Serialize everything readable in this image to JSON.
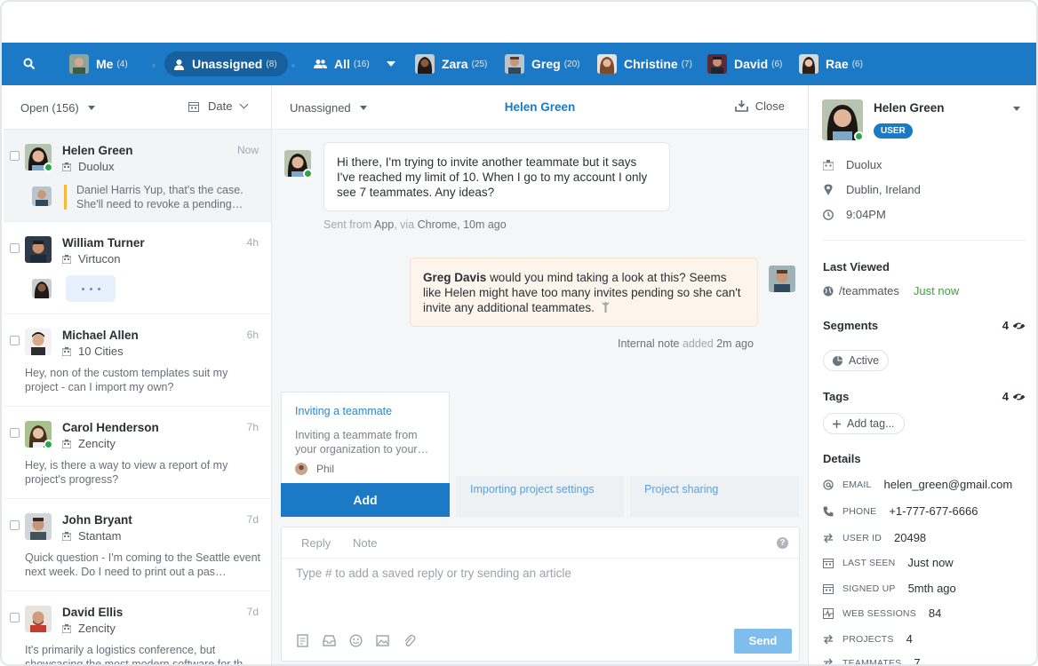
{
  "nav": {
    "items": [
      {
        "label": "Me",
        "count": "(4)"
      },
      {
        "label": "Unassigned",
        "count": "(8)"
      },
      {
        "label": "All",
        "count": "(16)"
      },
      {
        "label": "Zara",
        "count": "(25)"
      },
      {
        "label": "Greg",
        "count": "(20)"
      },
      {
        "label": "Christine",
        "count": "(7)"
      },
      {
        "label": "David",
        "count": "(6)"
      },
      {
        "label": "Rae",
        "count": "(6)"
      }
    ]
  },
  "inbox": {
    "filter_label": "Open (156)",
    "sort_label": "Date",
    "conversations": [
      {
        "name": "Helen Green",
        "time": "Now",
        "company": "Duolux",
        "preview": "Daniel Harris Yup, that's the case. She'll need to revoke a pending…"
      },
      {
        "name": "William Turner",
        "time": "4h",
        "company": "Virtucon",
        "preview": ""
      },
      {
        "name": "Michael Allen",
        "time": "6h",
        "company": "10 Cities",
        "preview": "Hey, non of the custom templates suit my project - can I import my own?"
      },
      {
        "name": "Carol Henderson",
        "time": "7h",
        "company": "Zencity",
        "preview": "Hey, is there a way to view a report of my project's progress?"
      },
      {
        "name": "John Bryant",
        "time": "7d",
        "company": "Stantam",
        "preview": "Quick question - I'm coming to the Seattle event next week. Do I need to print out a pas…"
      },
      {
        "name": "David Ellis",
        "time": "7d",
        "company": "Zencity",
        "preview": "It's primarily a logistics conference, but showcasing the most modern software for th…"
      }
    ]
  },
  "conversation": {
    "assignee": "Unassigned",
    "title": "Helen Green",
    "close_label": "Close",
    "message": "Hi there, I'm trying to invite another teammate but it says I've reached my limit of 10. When I go to my account I only see 7 teammates. Any ideas?",
    "message_meta": {
      "prefix": "Sent from",
      "app": "App",
      "via": ", via",
      "browser": "Chrome",
      "time": ", 10m ago"
    },
    "note_author": "Greg Davis",
    "note_text": "would you mind taking a look at this? Seems like Helen might have too many invites pending so she can't invite any additional teammates.",
    "note_meta": {
      "type": "Internal note",
      "verb": "added",
      "time": "2m ago"
    },
    "suggestion": {
      "title": "Inviting a teammate",
      "body": "Inviting a teammate from your organization to your…",
      "author": "Phil",
      "add_label": "Add"
    },
    "other_suggestions": [
      "Importing project settings",
      "Project sharing"
    ],
    "composer": {
      "tab_reply": "Reply",
      "tab_note": "Note",
      "help": "?",
      "placeholder": "Type # to add a saved reply or try sending an article",
      "send_label": "Send"
    }
  },
  "profile": {
    "name": "Helen Green",
    "badge": "USER",
    "company": "Duolux",
    "location": "Dublin, Ireland",
    "local_time": "9:04PM",
    "last_viewed_heading": "Last Viewed",
    "last_viewed_page": "/teammates",
    "last_viewed_time": "Just now",
    "segments_heading": "Segments",
    "segments_count": "4",
    "segment_chip": "Active",
    "tags_heading": "Tags",
    "tags_count": "4",
    "add_tag": "Add tag...",
    "details_heading": "Details",
    "details": [
      {
        "label": "EMAIL",
        "value": "helen_green@gmail.com"
      },
      {
        "label": "PHONE",
        "value": "+1-777-677-6666"
      },
      {
        "label": "USER ID",
        "value": "20498"
      },
      {
        "label": "LAST SEEN",
        "value": "Just now"
      },
      {
        "label": "SIGNED UP",
        "value": "5mth ago"
      },
      {
        "label": "WEB SESSIONS",
        "value": "84"
      },
      {
        "label": "PROJECTS",
        "value": "4"
      },
      {
        "label": "TEAMMATES",
        "value": "7"
      }
    ]
  },
  "colors": {
    "brand": "#1b79c6",
    "online": "#27a745",
    "note_bg": "#fdf5ec"
  }
}
